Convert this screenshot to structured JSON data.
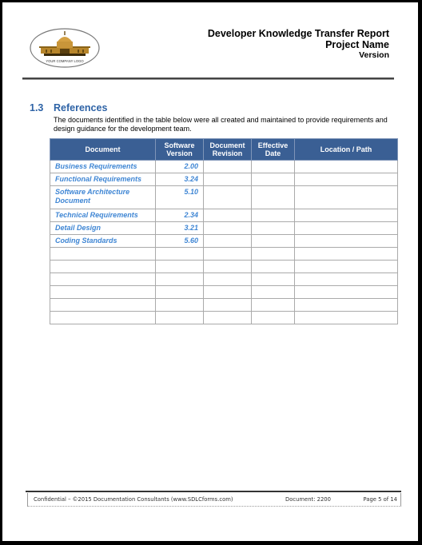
{
  "header": {
    "logo_text": "YOUR COMPANY LOGO",
    "title": "Developer Knowledge Transfer Report",
    "project": "Project Name",
    "version": "Version"
  },
  "section": {
    "number": "1.3",
    "title": "References",
    "body": "The documents identified in the table below were all created and maintained to provide requirements and design guidance for the development team."
  },
  "table": {
    "columns": [
      "Document",
      "Software Version",
      "Document Revision",
      "Effective Date",
      "Location / Path"
    ],
    "column_lines": [
      [
        "Document"
      ],
      [
        "Software",
        "Version"
      ],
      [
        "Document",
        "Revision"
      ],
      [
        "Effective",
        "Date"
      ],
      [
        "Location / Path"
      ]
    ],
    "rows": [
      {
        "document": "Business Requirements",
        "version": "2.00",
        "revision": "",
        "date": "",
        "path": ""
      },
      {
        "document": "Functional Requirements",
        "version": "3.24",
        "revision": "",
        "date": "",
        "path": ""
      },
      {
        "document": "Software Architecture Document",
        "version": "5.10",
        "revision": "",
        "date": "",
        "path": ""
      },
      {
        "document": "Technical Requirements",
        "version": "2.34",
        "revision": "",
        "date": "",
        "path": ""
      },
      {
        "document": "Detail Design",
        "version": "3.21",
        "revision": "",
        "date": "",
        "path": ""
      },
      {
        "document": "Coding Standards",
        "version": "5.60",
        "revision": "",
        "date": "",
        "path": ""
      },
      {
        "document": "",
        "version": "",
        "revision": "",
        "date": "",
        "path": ""
      },
      {
        "document": "",
        "version": "",
        "revision": "",
        "date": "",
        "path": ""
      },
      {
        "document": "",
        "version": "",
        "revision": "",
        "date": "",
        "path": ""
      },
      {
        "document": "",
        "version": "",
        "revision": "",
        "date": "",
        "path": ""
      },
      {
        "document": "",
        "version": "",
        "revision": "",
        "date": "",
        "path": ""
      },
      {
        "document": "",
        "version": "",
        "revision": "",
        "date": "",
        "path": ""
      }
    ]
  },
  "footer": {
    "confidential": "Confidential – ©2015 Documentation Consultants (www.SDLCforms.com)",
    "document": "Document: 2200",
    "page": "Page 5 of 14"
  },
  "colors": {
    "accent": "#2e63a6",
    "header_fill": "#3a5f94",
    "link_text": "#3f86d4"
  }
}
